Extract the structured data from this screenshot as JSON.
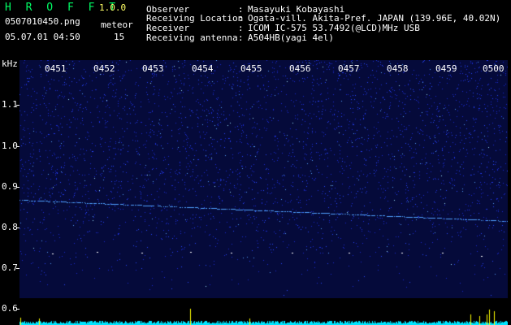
{
  "header": {
    "app_title": "H R O F F T",
    "app_version": "1.0.0",
    "filename": "0507010450.png",
    "meteor_label": "meteor",
    "timestamp": "05.07.01 04:50",
    "meteor_count": "15"
  },
  "info": [
    {
      "label": "Observer",
      "value": "Masayuki Kobayashi"
    },
    {
      "label": "Receiving Location",
      "value": "Ogata-vill. Akita-Pref. JAPAN (139.96E, 40.02N)"
    },
    {
      "label": "Receiver",
      "value": "ICOM IC-575 53.7492(@LCD)MHz USB"
    },
    {
      "label": "Receiving antenna",
      "value": "A504HB(yagi 4el)"
    }
  ],
  "axis": {
    "unit": "kHz",
    "yticks": [
      "1.1",
      "1.0",
      "0.9",
      "0.8",
      "0.7",
      "0.6"
    ],
    "time_labels": [
      "0451",
      "0452",
      "0453",
      "0454",
      "0455",
      "0456",
      "0457",
      "0458",
      "0459",
      "0500"
    ]
  },
  "colors": {
    "title": "#00ff66",
    "version": "#ffff66",
    "spectrum_bg": "#050a3a",
    "noise": "#2a45ff",
    "carrier": "#4fa0ff",
    "level": "#00e5ff",
    "peak": "#ffff00"
  }
}
